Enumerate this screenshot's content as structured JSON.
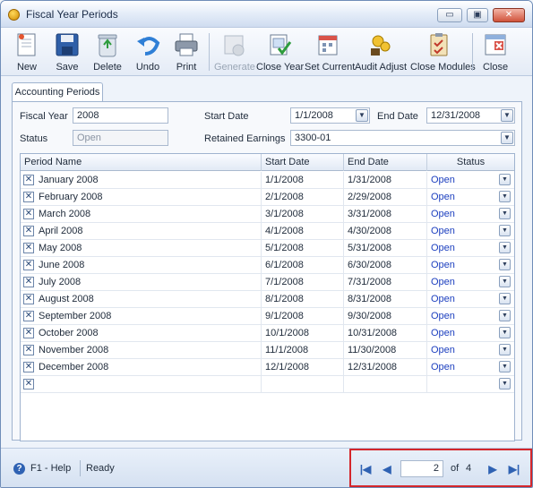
{
  "window": {
    "title": "Fiscal Year Periods",
    "minimize_glyph": "▭",
    "maximize_glyph": "▣",
    "close_glyph": "✕"
  },
  "toolbar": {
    "new": "New",
    "save": "Save",
    "delete": "Delete",
    "undo": "Undo",
    "print": "Print",
    "generate": "Generate",
    "close_year": "Close Year",
    "set_current": "Set Current",
    "audit_adjust": "Audit Adjust",
    "close_modules": "Close Modules",
    "close": "Close"
  },
  "tab": {
    "label": "Accounting Periods"
  },
  "form": {
    "fiscal_year_label": "Fiscal Year",
    "fiscal_year": "2008",
    "status_label": "Status",
    "status": "Open",
    "start_date_label": "Start Date",
    "start_date": "1/1/2008",
    "end_date_label": "End Date",
    "end_date": "12/31/2008",
    "retained_earnings_label": "Retained Earnings",
    "retained_earnings": "3300-01"
  },
  "grid": {
    "columns": {
      "name": "Period Name",
      "start": "Start Date",
      "end": "End Date",
      "status": "Status"
    },
    "rows": [
      {
        "name": "January 2008",
        "start": "1/1/2008",
        "end": "1/31/2008",
        "status": "Open"
      },
      {
        "name": "February 2008",
        "start": "2/1/2008",
        "end": "2/29/2008",
        "status": "Open"
      },
      {
        "name": "March 2008",
        "start": "3/1/2008",
        "end": "3/31/2008",
        "status": "Open"
      },
      {
        "name": "April 2008",
        "start": "4/1/2008",
        "end": "4/30/2008",
        "status": "Open"
      },
      {
        "name": "May 2008",
        "start": "5/1/2008",
        "end": "5/31/2008",
        "status": "Open"
      },
      {
        "name": "June 2008",
        "start": "6/1/2008",
        "end": "6/30/2008",
        "status": "Open"
      },
      {
        "name": "July 2008",
        "start": "7/1/2008",
        "end": "7/31/2008",
        "status": "Open"
      },
      {
        "name": "August 2008",
        "start": "8/1/2008",
        "end": "8/31/2008",
        "status": "Open"
      },
      {
        "name": "September 2008",
        "start": "9/1/2008",
        "end": "9/30/2008",
        "status": "Open"
      },
      {
        "name": "October 2008",
        "start": "10/1/2008",
        "end": "10/31/2008",
        "status": "Open"
      },
      {
        "name": "November 2008",
        "start": "11/1/2008",
        "end": "11/30/2008",
        "status": "Open"
      },
      {
        "name": "December 2008",
        "start": "12/1/2008",
        "end": "12/31/2008",
        "status": "Open"
      },
      {
        "name": "",
        "start": "",
        "end": "",
        "status": ""
      }
    ],
    "delete_glyph": "✕",
    "dropdown_glyph": "▼"
  },
  "statusbar": {
    "help": "F1 - Help",
    "ready": "Ready"
  },
  "pager": {
    "current_page": "2",
    "of_label": "of",
    "total_pages": "4",
    "first_glyph": "|◀",
    "prev_glyph": "◀",
    "next_glyph": "▶",
    "last_glyph": "▶|"
  },
  "colors": {
    "status_open": "#1c3fbf",
    "highlight_border": "#d4262b",
    "accent": "#2f62b3"
  }
}
